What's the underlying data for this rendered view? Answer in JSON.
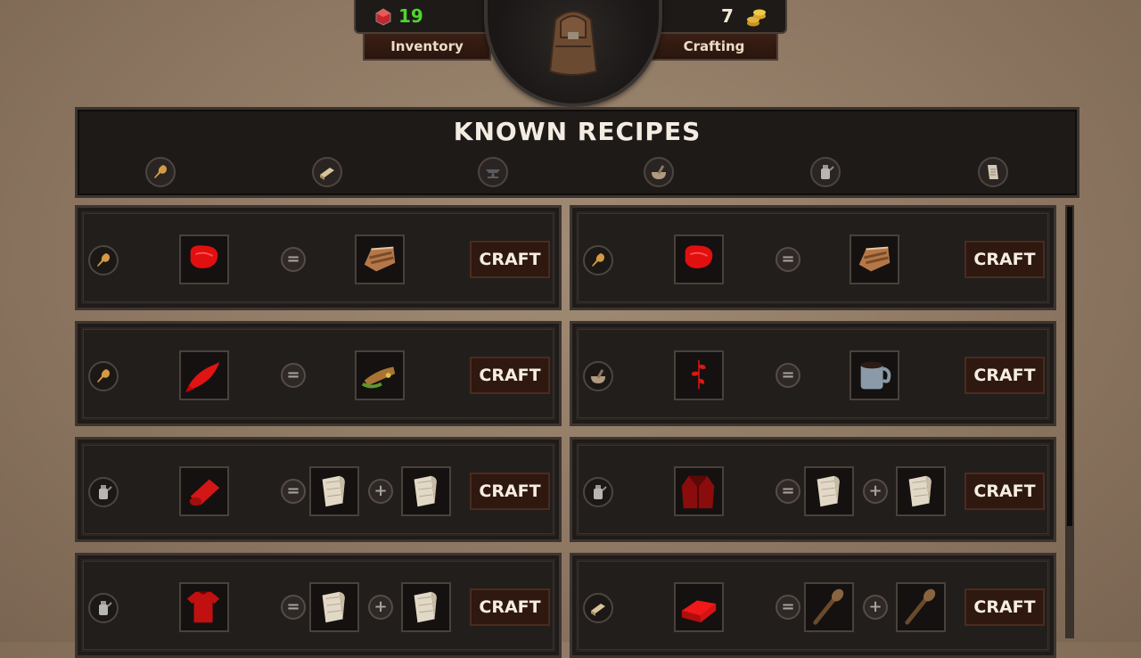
{
  "hud": {
    "gems": "19",
    "gold": "7",
    "tab_inventory": "Inventory",
    "tab_crafting": "Crafting"
  },
  "panel": {
    "title": "KNOWN RECIPES",
    "categories": [
      "food-icon",
      "wood-icon",
      "anvil-icon",
      "mortar-icon",
      "oil-can-icon",
      "paper-icon"
    ]
  },
  "recipes": [
    {
      "category": "food-icon",
      "input": "raw-meat-icon",
      "outputs": [
        "cooked-meat-icon"
      ],
      "button": "CRAFT"
    },
    {
      "category": "food-icon",
      "input": "raw-meat-icon",
      "outputs": [
        "cooked-meat-icon"
      ],
      "button": "CRAFT"
    },
    {
      "category": "food-icon",
      "input": "raw-fish-icon",
      "outputs": [
        "cooked-fish-icon"
      ],
      "button": "CRAFT"
    },
    {
      "category": "mortar-icon",
      "input": "herb-icon",
      "outputs": [
        "tea-mug-icon"
      ],
      "button": "CRAFT"
    },
    {
      "category": "oil-can-icon",
      "input": "cloth-roll-icon",
      "outputs": [
        "fabric-icon",
        "fabric-icon"
      ],
      "button": "CRAFT"
    },
    {
      "category": "oil-can-icon",
      "input": "coat-icon",
      "outputs": [
        "fabric-icon",
        "fabric-icon"
      ],
      "button": "CRAFT"
    },
    {
      "category": "oil-can-icon",
      "input": "shirt-icon",
      "outputs": [
        "fabric-icon",
        "fabric-icon"
      ],
      "button": "CRAFT"
    },
    {
      "category": "wood-icon",
      "input": "brick-icon",
      "outputs": [
        "club-icon",
        "club-icon"
      ],
      "button": "CRAFT"
    }
  ],
  "colors": {
    "gems": "#4ed62e",
    "panel_bg": "#1e1a18",
    "button_bg": "#2e1810",
    "highlight_red": "#d91414"
  }
}
